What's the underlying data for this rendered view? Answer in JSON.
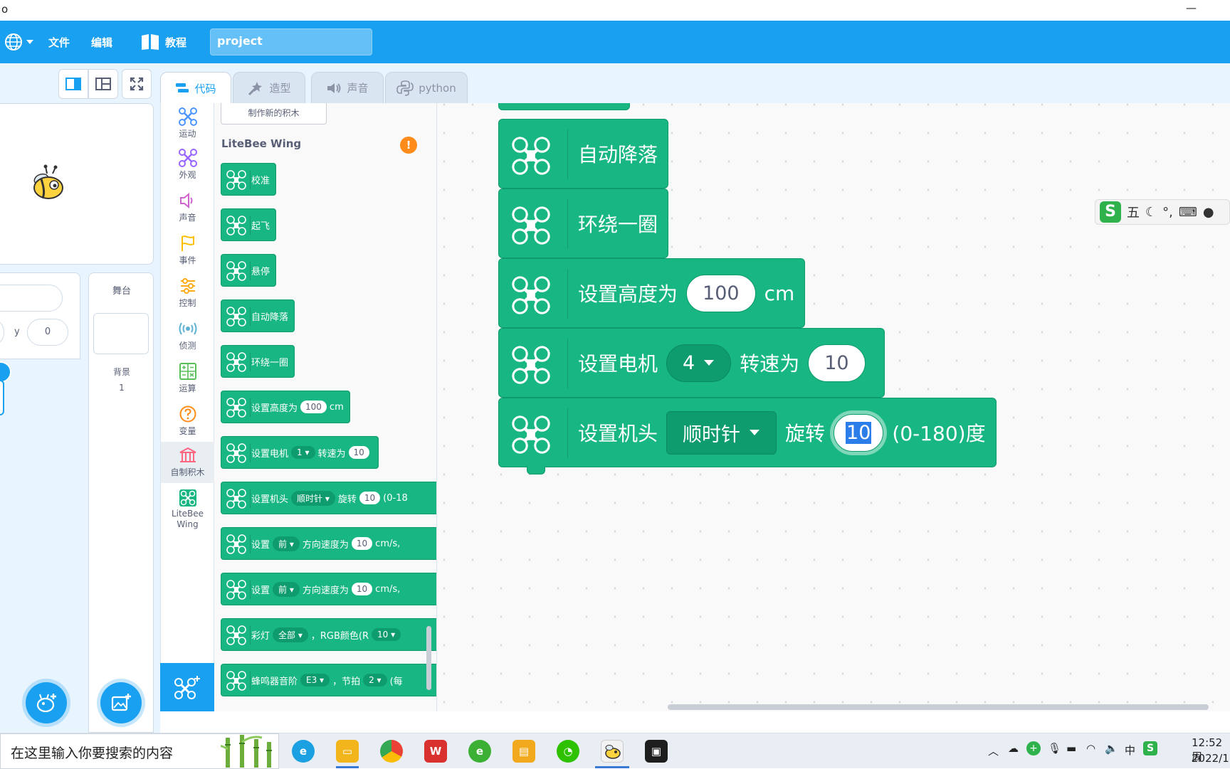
{
  "window": {
    "title_fragment": "o",
    "minimize_glyph": "—"
  },
  "menubar": {
    "file": "文件",
    "edit": "编辑",
    "tutorial": "教程",
    "project_name": "project"
  },
  "tabs": [
    {
      "label": "代码",
      "active": true
    },
    {
      "label": "造型",
      "active": false
    },
    {
      "label": "声音",
      "active": false
    },
    {
      "label": "python",
      "active": false
    }
  ],
  "sprite_info": {
    "y_label": "y",
    "y_value": "0"
  },
  "stage_panel": {
    "title": "舞台",
    "backdrop_label": "背景",
    "backdrop_count": "1"
  },
  "categories": [
    {
      "label": "运动",
      "color": "#4c97ff"
    },
    {
      "label": "外观",
      "color": "#9966ff"
    },
    {
      "label": "声音",
      "color": "#cf63cf"
    },
    {
      "label": "事件",
      "color": "#ffbf00"
    },
    {
      "label": "控制",
      "color": "#ffab19"
    },
    {
      "label": "侦测",
      "color": "#5cb1d6"
    },
    {
      "label": "运算",
      "color": "#59c059"
    },
    {
      "label": "变量",
      "color": "#ff8c1a"
    },
    {
      "label": "自制积木",
      "color": "#ff6680"
    },
    {
      "label": "LiteBee Wing",
      "color": "#17b682"
    }
  ],
  "palette": {
    "make_block": "制作新的积木",
    "section_title": "LiteBee Wing",
    "warning_glyph": "!",
    "blocks": {
      "calibrate": "校准",
      "takeoff": "起飞",
      "hover": "悬停",
      "auto_land": "自动降落",
      "circle": "环绕一圈",
      "set_height": {
        "label": "设置高度为",
        "value": "100",
        "unit": "cm"
      },
      "set_motor": {
        "label": "设置电机",
        "motor": "1",
        "mid": "转速为",
        "value": "10"
      },
      "set_head": {
        "label": "设置机头",
        "dir": "顺时针",
        "mid": "旋转",
        "value": "10",
        "tail": "(0-18"
      },
      "set_speed1": {
        "label": "设置",
        "dir": "前",
        "mid": "方向速度为",
        "value": "10",
        "unit": "cm/s,"
      },
      "set_speed2": {
        "label": "设置",
        "dir": "前",
        "mid": "方向速度为",
        "value": "10",
        "unit": "cm/s,"
      },
      "led": {
        "label": "彩灯",
        "target": "全部",
        "mid": "，RGB颜色(R",
        "value": "10"
      },
      "buzzer": {
        "label": "蜂鸣器音阶",
        "note": "E3",
        "mid": "，节拍",
        "beat": "2",
        "tail": "(每"
      }
    }
  },
  "workspace": {
    "auto_land": "自动降落",
    "circle": "环绕一圈",
    "set_height": {
      "label": "设置高度为",
      "value": "100",
      "unit": "cm"
    },
    "set_motor": {
      "label": "设置电机",
      "motor": "4",
      "mid": "转速为",
      "value": "10"
    },
    "set_head": {
      "label": "设置机头",
      "dir": "顺时针",
      "mid": "旋转",
      "value": "10",
      "tail": "(0-180)度"
    }
  },
  "ime": {
    "logo": "S",
    "mode": "五",
    "punct": "°,"
  },
  "taskbar": {
    "search_placeholder": "在这里输入你要搜索的内容",
    "time": "12:52 周",
    "date": "2022/1",
    "ime_lang": "中"
  },
  "colors": {
    "brand_blue": "#1aa0f0",
    "block_green": "#17b682",
    "block_dark": "#0e9c6e"
  }
}
